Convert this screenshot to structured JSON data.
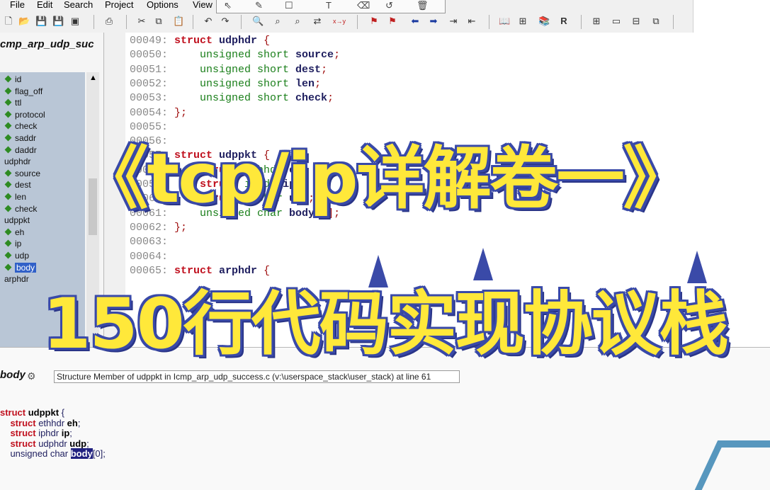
{
  "menu": [
    "File",
    "Edit",
    "Search",
    "Project",
    "Options",
    "View"
  ],
  "toolbar_icons": [
    "new-file-icon",
    "open-folder-icon",
    "save-icon",
    "save-all-icon",
    "close-file-icon",
    "print-icon",
    "cut-icon",
    "copy-icon",
    "paste-icon",
    "undo-icon",
    "redo-icon",
    "find-icon",
    "find-next-icon",
    "find-prev-icon",
    "replace-icon",
    "xy-icon",
    "bookmark-icon",
    "bookmark-next-icon",
    "back-icon",
    "forward-icon",
    "jump-icon",
    "jump-back-icon",
    "lookup-icon",
    "symbol-icon",
    "browse-icon",
    "refresh-icon",
    "layout1-icon",
    "layout2-icon",
    "layout3-icon",
    "layout4-icon"
  ],
  "left_pane": {
    "file_title": "cmp_arp_udp_suc",
    "tree_items": [
      {
        "label": "id",
        "indent": 1
      },
      {
        "label": "flag_off",
        "indent": 1
      },
      {
        "label": "ttl",
        "indent": 1
      },
      {
        "label": "protocol",
        "indent": 1
      },
      {
        "label": "check",
        "indent": 1
      },
      {
        "label": "saddr",
        "indent": 1
      },
      {
        "label": "daddr",
        "indent": 1
      },
      {
        "label": "udphdr",
        "indent": 0
      },
      {
        "label": "source",
        "indent": 1
      },
      {
        "label": "dest",
        "indent": 1
      },
      {
        "label": "len",
        "indent": 1
      },
      {
        "label": "check",
        "indent": 1
      },
      {
        "label": "udppkt",
        "indent": 0
      },
      {
        "label": "eh",
        "indent": 1
      },
      {
        "label": "ip",
        "indent": 1
      },
      {
        "label": "udp",
        "indent": 1
      },
      {
        "label": "body",
        "indent": 1,
        "selected": true
      },
      {
        "label": "arphdr",
        "indent": 0
      }
    ]
  },
  "code_lines": [
    {
      "num": "00049:",
      "parts": [
        [
          "kw",
          "struct "
        ],
        [
          "nm",
          "udphdr "
        ],
        [
          "pu",
          "{"
        ]
      ]
    },
    {
      "num": "00050:",
      "parts": [
        [
          "ty",
          "    unsigned short "
        ],
        [
          "nm",
          "source"
        ],
        [
          "pu",
          ";"
        ]
      ]
    },
    {
      "num": "00051:",
      "parts": [
        [
          "ty",
          "    unsigned short "
        ],
        [
          "nm",
          "dest"
        ],
        [
          "pu",
          ";"
        ]
      ]
    },
    {
      "num": "00052:",
      "parts": [
        [
          "ty",
          "    unsigned short "
        ],
        [
          "nm",
          "len"
        ],
        [
          "pu",
          ";"
        ]
      ]
    },
    {
      "num": "00053:",
      "parts": [
        [
          "ty",
          "    unsigned short "
        ],
        [
          "nm",
          "check"
        ],
        [
          "pu",
          ";"
        ]
      ]
    },
    {
      "num": "00054:",
      "parts": [
        [
          "pu",
          "};"
        ]
      ]
    },
    {
      "num": "00055:",
      "parts": []
    },
    {
      "num": "00056:",
      "parts": []
    },
    {
      "num": "00057:",
      "parts": [
        [
          "kw",
          "struct "
        ],
        [
          "nm",
          "udppkt "
        ],
        [
          "pu",
          "{"
        ]
      ]
    },
    {
      "num": "00058:",
      "parts": [
        [
          "kw",
          "    struct "
        ],
        [
          "ty",
          "ethhdr "
        ],
        [
          "nm",
          "eh"
        ],
        [
          "pu",
          ";"
        ]
      ]
    },
    {
      "num": "00059:",
      "parts": [
        [
          "kw",
          "    struct "
        ],
        [
          "ty",
          "iphdr "
        ],
        [
          "nm",
          "ip"
        ],
        [
          "pu",
          ";"
        ]
      ]
    },
    {
      "num": "00060:",
      "parts": [
        [
          "kw",
          "    struct "
        ],
        [
          "ty",
          "udphdr "
        ],
        [
          "nm",
          "udp"
        ],
        [
          "pu",
          ";"
        ]
      ]
    },
    {
      "num": "00061:",
      "parts": [
        [
          "ty",
          "    unsigned char "
        ],
        [
          "nm",
          "body"
        ],
        [
          "pu",
          "[0];"
        ]
      ]
    },
    {
      "num": "00062:",
      "parts": [
        [
          "pu",
          "};"
        ]
      ]
    },
    {
      "num": "00063:",
      "parts": []
    },
    {
      "num": "00064:",
      "parts": []
    },
    {
      "num": "00065:",
      "parts": [
        [
          "kw",
          "struct "
        ],
        [
          "nm",
          "arphdr "
        ],
        [
          "pu",
          "{"
        ]
      ]
    }
  ],
  "bottom": {
    "symbol_name": "body",
    "symbol_info": "Structure Member of udppkt in Icmp_arp_udp_success.c (v:\\userspace_stack\\user_stack) at line 61",
    "context_lines": [
      [
        [
          "k",
          "struct "
        ],
        [
          "b",
          "udppkt "
        ],
        [
          "t",
          "{"
        ]
      ],
      [
        [
          "k",
          "    struct "
        ],
        [
          "t",
          "ethhdr "
        ],
        [
          "b",
          "eh"
        ],
        [
          "t",
          ";"
        ]
      ],
      [
        [
          "k",
          "    struct "
        ],
        [
          "t",
          "iphdr "
        ],
        [
          "b",
          "ip"
        ],
        [
          "t",
          ";"
        ]
      ],
      [
        [
          "k",
          "    struct "
        ],
        [
          "t",
          "udphdr "
        ],
        [
          "b",
          "udp"
        ],
        [
          "t",
          ";"
        ]
      ],
      [
        [
          "t",
          "    unsigned char "
        ],
        [
          "hl",
          "body"
        ],
        [
          "t",
          "[0];"
        ]
      ]
    ]
  },
  "overlay": {
    "title_line1": "《tcp/ip详解卷一》",
    "title_line2": "150行代码实现协议栈",
    "fill_color": "#ffe83a",
    "outline_color": "#3a4aa8"
  }
}
